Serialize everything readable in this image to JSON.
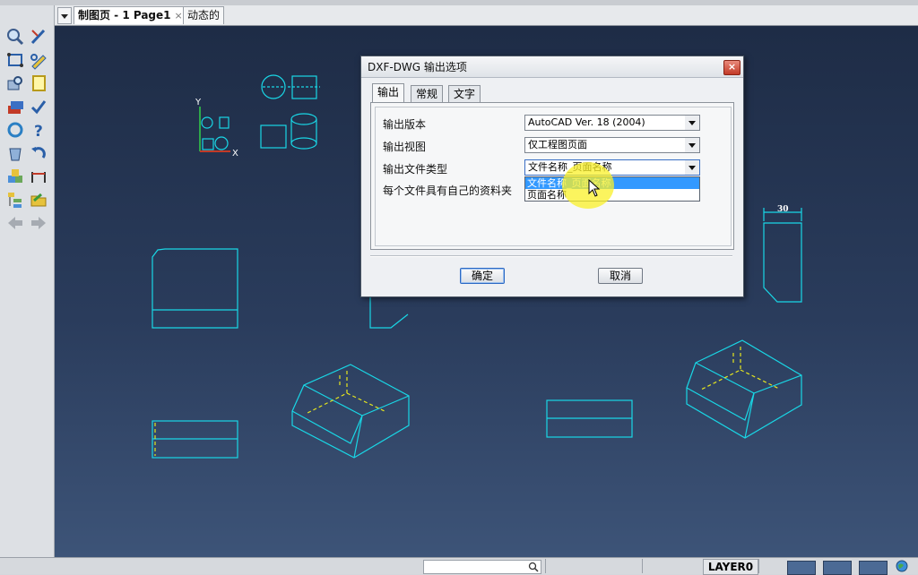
{
  "tabs": [
    {
      "label": "制图页 - 1 Page1",
      "active": true,
      "close": "×"
    },
    {
      "label": "动态的",
      "active": false
    }
  ],
  "icons": [
    "search-zoom-icon",
    "pencil-icon",
    "rectangle-icon",
    "edit-icon",
    "view-icon",
    "note-icon",
    "layers-icon",
    "check-icon",
    "refresh-icon",
    "help-icon",
    "bucket-icon",
    "undo-icon",
    "cubes-icon",
    "dimension-icon",
    "tree-icon",
    "folder-icon",
    "arrow-left-icon",
    "arrow-right-icon"
  ],
  "drawing": {
    "dimension_text": "30",
    "axis_y": "Y",
    "axis_x": "X"
  },
  "dialog": {
    "title": "DXF-DWG 输出选项",
    "close": "×",
    "tabs": [
      "输出",
      "常规",
      "文字"
    ],
    "active_tab": "输出",
    "fields": [
      {
        "label": "输出版本",
        "value": "AutoCAD Ver. 18 (2004)"
      },
      {
        "label": "输出视图",
        "value": "仅工程图页面"
      },
      {
        "label": "输出文件类型",
        "value": "文件名称_页面名称"
      },
      {
        "label": "每个文件具有自己的资料夹",
        "value": ""
      }
    ],
    "dropdown_options": [
      "文件名称_页面名称",
      "页面名称"
    ],
    "dropdown_selected": 0,
    "ok_label": "确定",
    "cancel_label": "取消"
  },
  "status": {
    "layer": "LAYER0",
    "search_placeholder": ""
  },
  "colors": {
    "canvas_top": "#1e2c46",
    "canvas_bottom": "#3d5478",
    "geometry": "#19d7e6",
    "hidden_lines": "#e6e61e",
    "selection": "#3399ff"
  }
}
